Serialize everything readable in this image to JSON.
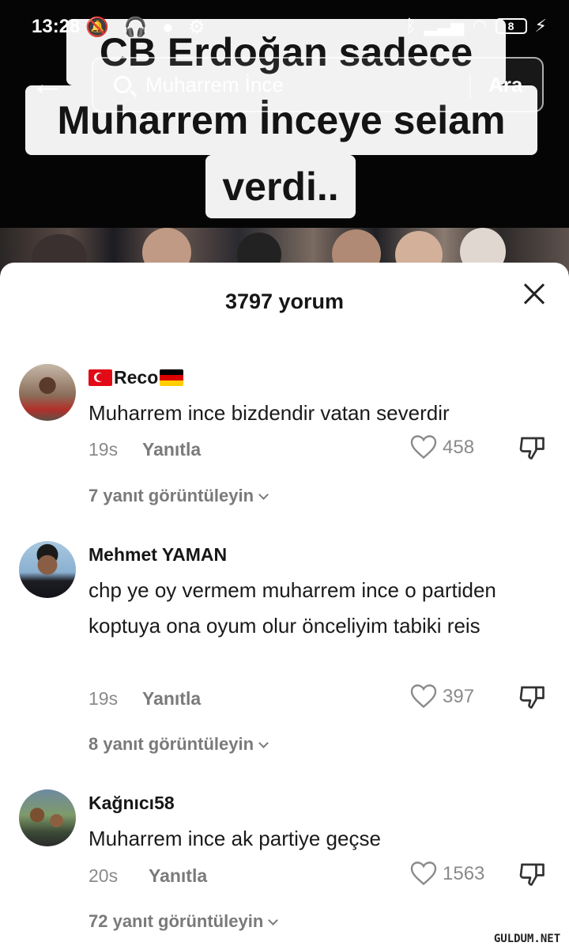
{
  "status_bar": {
    "time": "13:28",
    "battery": "8"
  },
  "video": {
    "caption_line1": "CB Erdoğan sadece",
    "caption_line2": "Muharrem İnceye selam",
    "caption_line3": "verdi.."
  },
  "search": {
    "query": "Muharrem İnce",
    "button_label": "Ara"
  },
  "comments_panel": {
    "title": "3797 yorum",
    "comments": [
      {
        "author": "Reco",
        "text": "Muharrem ince bizdendir vatan severdir",
        "time": "19s",
        "reply_label": "Yanıtla",
        "likes": "458",
        "view_replies": "7 yanıt görüntüleyin"
      },
      {
        "author": "Mehmet YAMAN",
        "text": "chp ye oy vermem muharrem ince o partiden koptuya ona oyum olur önceliyim tabiki reis",
        "time": "19s",
        "reply_label": "Yanıtla",
        "likes": "397",
        "view_replies": "8 yanıt görüntüleyin"
      },
      {
        "author": "Kağnıcı58",
        "text": "Muharrem ince ak partiye geçse",
        "time": "20s",
        "reply_label": "Yanıtla",
        "likes": "1563",
        "view_replies": "72 yanıt görüntüleyin"
      }
    ]
  },
  "watermark": "GULDUM.NET"
}
